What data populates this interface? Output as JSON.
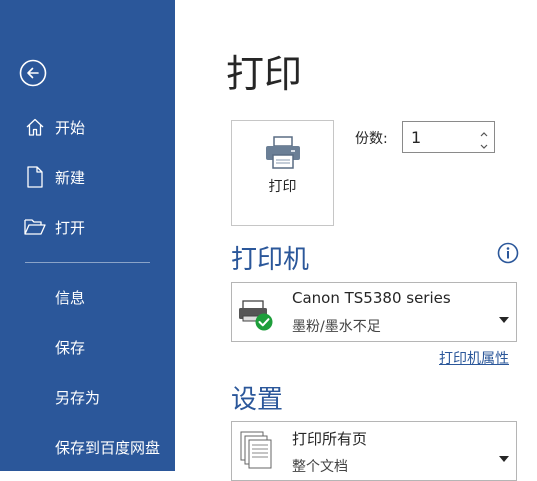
{
  "sidebar": {
    "items": [
      {
        "label": "开始",
        "icon": "home-icon"
      },
      {
        "label": "新建",
        "icon": "new-document-icon"
      },
      {
        "label": "打开",
        "icon": "open-folder-icon"
      },
      {
        "label": "信息"
      },
      {
        "label": "保存"
      },
      {
        "label": "另存为"
      },
      {
        "label": "保存到百度网盘"
      }
    ]
  },
  "main": {
    "title": "打印",
    "print_button_label": "打印",
    "copies_label": "份数:",
    "copies_value": "1",
    "printer_section_title": "打印机",
    "printer_name": "Canon TS5380 series",
    "printer_status": "墨粉/墨水不足",
    "printer_properties_link": "打印机属性",
    "settings_section_title": "设置",
    "setting_main": "打印所有页",
    "setting_sub": "整个文档"
  },
  "colors": {
    "sidebar_bg": "#2b579a",
    "accent": "#2b579a",
    "status_ok": "#1e9e3b"
  }
}
